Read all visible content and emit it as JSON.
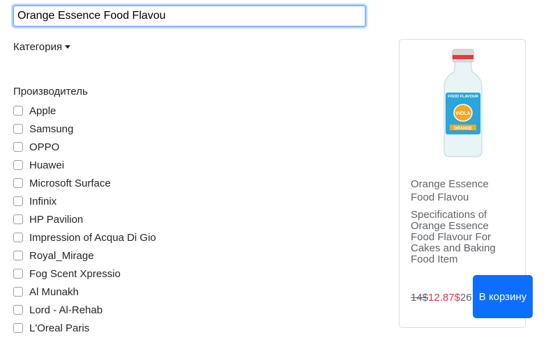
{
  "search": {
    "value": "Orange Essence Food Flavou"
  },
  "filters": {
    "category_label": "Категория",
    "manufacturer_label": "Производитель",
    "brands": [
      "Apple",
      "Samsung",
      "OPPO",
      "Huawei",
      "Microsoft Surface",
      "Infinix",
      "HP Pavilion",
      "Impression of Acqua Di Gio",
      "Royal_Mirage",
      "Fog Scent Xpressio",
      "Al Munakh",
      "Lord - Al-Rehab",
      "L'Oreal Paris"
    ]
  },
  "product": {
    "name": "Orange Essence Food Flavou",
    "description": "Specifications of Orange Essence Food Flavour For Cakes and Baking Food Item",
    "image_label_top": "FOOD FLAVOUR",
    "image_brand": "VIOLA",
    "image_label_bottom": "ORANGE",
    "price_old": "14$",
    "price_new": "12.87$",
    "price_tail": "26",
    "cart_button": "В корзину"
  },
  "colors": {
    "primary": "#0d6efd",
    "sale": "#dc3545",
    "label_blue": "#2aa6d8"
  }
}
